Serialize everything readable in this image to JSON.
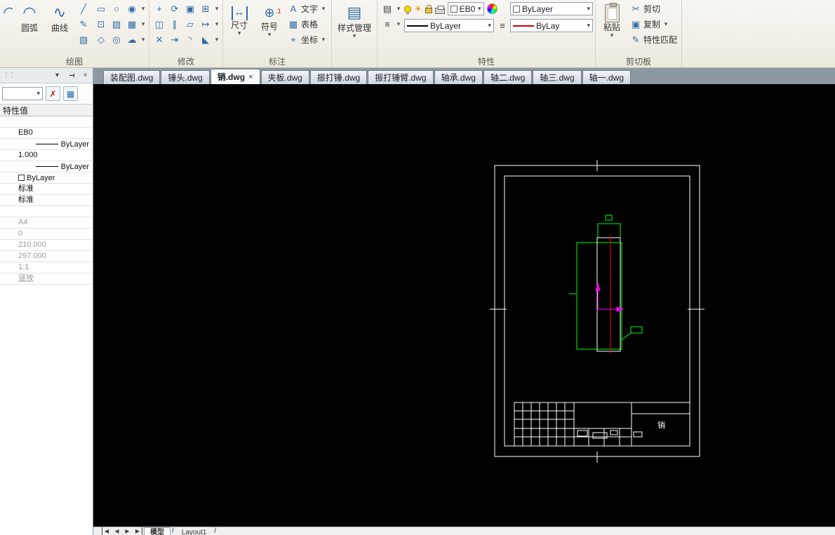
{
  "ribbon": {
    "groups": {
      "draw": {
        "label": "绘图"
      },
      "modify": {
        "label": "修改"
      },
      "annotate": {
        "label": "标注"
      },
      "properties": {
        "label": "特性"
      },
      "clipboard": {
        "label": "剪切板"
      }
    },
    "draw_tools": {
      "arc": "圆弧",
      "spline": "曲线"
    },
    "annotate_tools": {
      "dimension": "尺寸",
      "symbol": "符号",
      "text": "文字",
      "table": "表格",
      "coordinate": "坐标",
      "style_manager": "样式管理"
    },
    "property_controls": {
      "color_combo_value": "EB0",
      "layer_color_combo_value": "ByLayer",
      "linetype_combo_value": "ByLayer",
      "lineweight_combo_value": "ByLay"
    },
    "clipboard_tools": {
      "paste": "粘贴",
      "cut": "剪切",
      "copy": "复制",
      "match_properties": "特性匹配"
    }
  },
  "doc_tabs": {
    "close_glyph": "×",
    "items": [
      {
        "label": "装配图.dwg"
      },
      {
        "label": "锤头.dwg"
      },
      {
        "label": "销.dwg",
        "active": true
      },
      {
        "label": "夹板.dwg"
      },
      {
        "label": "振打锤.dwg"
      },
      {
        "label": "振打锤臂.dwg"
      },
      {
        "label": "轴承.dwg"
      },
      {
        "label": "轴二.dwg"
      },
      {
        "label": "轴三.dwg"
      },
      {
        "label": "轴一.dwg"
      }
    ]
  },
  "panel": {
    "header_title": "特性值",
    "rows": [
      {
        "value": ""
      },
      {
        "value": "EB0"
      },
      {
        "value": "ByLayer"
      },
      {
        "value": "1.000"
      },
      {
        "value": "ByLayer"
      },
      {
        "value": "ByLayer"
      },
      {
        "value": "标准"
      },
      {
        "value": "标准"
      },
      {
        "value": ""
      },
      {
        "value": "A4"
      },
      {
        "value": "0"
      },
      {
        "value": "210.000"
      },
      {
        "value": "297.000"
      },
      {
        "value": "1:1"
      },
      {
        "value": "竖放"
      }
    ]
  },
  "drawing": {
    "title_block_label": "销"
  },
  "status_bar": {
    "tabs": [
      "模型",
      "Layout1"
    ],
    "separator": "/"
  },
  "colors": {
    "canvas_bg": "#000000",
    "frame_white": "#ffffff",
    "part_green": "#00ff00",
    "centerline_red": "#ff0000",
    "ucs_magenta": "#ff00ff"
  },
  "icons": {
    "arc": "◠",
    "spline": "∿",
    "line1": "╱",
    "line2": "✎",
    "line3": "▧",
    "rect": "▭",
    "circ": "○",
    "ell": "◉",
    "pt": "⊡",
    "hat": "▨",
    "reg": "▦",
    "poly": "◇",
    "don": "◎",
    "cloud": "☁",
    "mv": "+",
    "rot": "⟳",
    "cp": "▣",
    "arr": "⊞",
    "mir": "◫",
    "off": "∥",
    "sca": "▱",
    "str": "↦",
    "tri": "✕",
    "ext": "⇥",
    "fil": "◝",
    "cha": "◣",
    "dim": "↔",
    "sym": "⊕",
    "sym_sub": ".1",
    "txt": "A",
    "tbl": "▦",
    "coord": "⌖",
    "style": "▤",
    "sun": "☀",
    "swap": "⇄",
    "caret": "▾",
    "menu": "≡",
    "page": "▤",
    "cut": "✂",
    "copy": "▣",
    "brush": "✎",
    "pick": "✗",
    "grid9": "▦",
    "close": "×",
    "pin": "T",
    "grip": "⋮⋮",
    "navL": "◀",
    "navR": "▶"
  }
}
